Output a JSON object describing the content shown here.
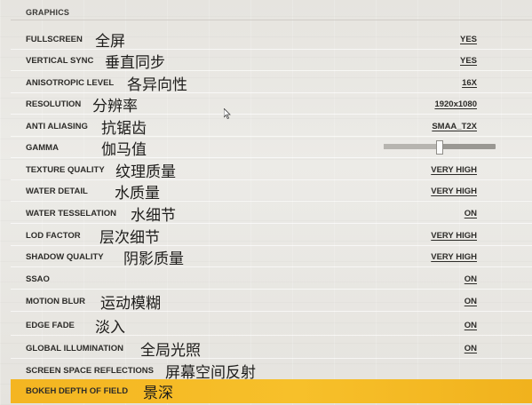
{
  "header": {
    "title": "GRAPHICS"
  },
  "settings": [
    {
      "label": "FULLSCREEN",
      "cn": "全屏",
      "value": "YES"
    },
    {
      "label": "VERTICAL SYNC",
      "cn": "垂直同步",
      "value": "YES"
    },
    {
      "label": "ANISOTROPIC LEVEL",
      "cn": "各异向性",
      "value": "16X"
    },
    {
      "label": "RESOLUTION",
      "cn": "分辨率",
      "value": "1920x1080"
    },
    {
      "label": "ANTI ALIASING",
      "cn": "抗锯齿",
      "value": "SMAA_T2X"
    },
    {
      "label": "GAMMA",
      "cn": "伽马值",
      "value": "",
      "slider": 0.5
    },
    {
      "label": "TEXTURE QUALITY",
      "cn": "纹理质量",
      "value": "VERY HIGH"
    },
    {
      "label": "WATER DETAIL",
      "cn": "水质量",
      "value": "VERY HIGH"
    },
    {
      "label": "WATER TESSELATION",
      "cn": "水细节",
      "value": "ON"
    },
    {
      "label": "LOD FACTOR",
      "cn": "层次细节",
      "value": "VERY HIGH"
    },
    {
      "label": "SHADOW QUALITY",
      "cn": "阴影质量",
      "value": "VERY HIGH"
    },
    {
      "label": "SSAO",
      "cn": "",
      "value": "ON"
    },
    {
      "label": "MOTION BLUR",
      "cn": "运动模糊",
      "value": "ON"
    },
    {
      "label": "EDGE FADE",
      "cn": "淡入",
      "value": "ON"
    },
    {
      "label": "GLOBAL ILLUMINATION",
      "cn": "全局光照",
      "value": "ON"
    },
    {
      "label": "SCREEN SPACE REFLECTIONS",
      "cn": "屏幕空间反射",
      "value": ""
    },
    {
      "label": "BOKEH DEPTH OF FIELD",
      "cn": "景深",
      "value": ""
    }
  ],
  "selected_index": 16,
  "colors": {
    "highlight": "#f4b521",
    "text": "#2d2c29"
  }
}
